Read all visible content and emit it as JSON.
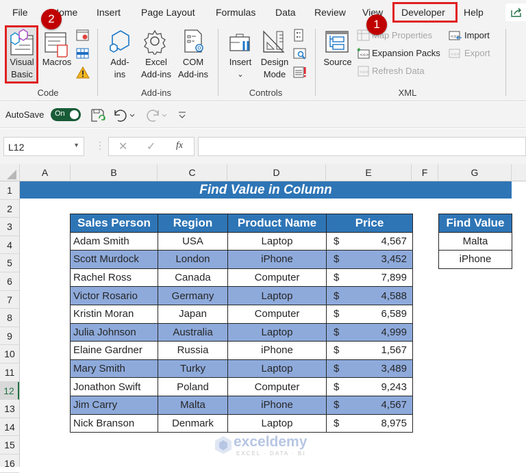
{
  "menu_tabs": [
    "File",
    "Home",
    "Insert",
    "Page Layout",
    "Formulas",
    "Data",
    "Review",
    "View",
    "Developer",
    "Help"
  ],
  "active_tab": "Developer",
  "share_icon": "share-icon",
  "step_badges": [
    "1",
    "2"
  ],
  "ribbon": {
    "code_group": {
      "label": "Code",
      "visual_basic": "Visual Basic",
      "visual_basic_lines": [
        "Visual",
        "Basic"
      ],
      "macros": "Macros",
      "small_icons": [
        "record-macro-icon",
        "relative-references-icon",
        "macro-security-icon"
      ]
    },
    "addins_group": {
      "label": "Add-ins",
      "addins_lines": [
        "Add-",
        "ins"
      ],
      "excel_addins_lines": [
        "Excel",
        "Add-ins"
      ],
      "com_addins_lines": [
        "COM",
        "Add-ins"
      ]
    },
    "controls_group": {
      "label": "Controls",
      "insert": "Insert",
      "insert_chevron": "⌄",
      "design_mode_lines": [
        "Design",
        "Mode"
      ],
      "small_icons": [
        "properties-icon",
        "view-code-icon",
        "run-dialog-icon"
      ]
    },
    "xml_group": {
      "label": "XML",
      "source": "Source",
      "map_properties": "Map Properties",
      "expansion_packs": "Expansion Packs",
      "refresh_data": "Refresh Data",
      "import": "Import",
      "export": "Export"
    }
  },
  "qat": {
    "autosave_label": "AutoSave",
    "autosave_state": "On"
  },
  "formula_bar": {
    "name_box": "L12",
    "fx": "fx",
    "formula": ""
  },
  "columns": [
    "A",
    "B",
    "C",
    "D",
    "E",
    "F",
    "G"
  ],
  "rows": [
    "1",
    "2",
    "3",
    "4",
    "5",
    "6",
    "7",
    "8",
    "9",
    "10",
    "11",
    "12",
    "13",
    "14",
    "15",
    "16"
  ],
  "selected_row": "12",
  "sheet": {
    "title": "Find Value in Column",
    "headers": [
      "Sales Person",
      "Region",
      "Product Name",
      "Price"
    ],
    "records": [
      {
        "person": "Adam Smith",
        "region": "USA",
        "product": "Laptop",
        "currency": "$",
        "price": "4,567"
      },
      {
        "person": "Scott Murdock",
        "region": "London",
        "product": "iPhone",
        "currency": "$",
        "price": "3,452"
      },
      {
        "person": "Rachel Ross",
        "region": "Canada",
        "product": "Computer",
        "currency": "$",
        "price": "7,899"
      },
      {
        "person": "Victor Rosario",
        "region": "Germany",
        "product": "Laptop",
        "currency": "$",
        "price": "4,588"
      },
      {
        "person": "Kristin Moran",
        "region": "Japan",
        "product": "Computer",
        "currency": "$",
        "price": "6,589"
      },
      {
        "person": "Julia Johnson",
        "region": "Australia",
        "product": "Laptop",
        "currency": "$",
        "price": "4,999"
      },
      {
        "person": "Elaine Gardner",
        "region": "Russia",
        "product": "iPhone",
        "currency": "$",
        "price": "1,567"
      },
      {
        "person": "Mary Smith",
        "region": "Turky",
        "product": "Laptop",
        "currency": "$",
        "price": "3,489"
      },
      {
        "person": "Jonathon Swift",
        "region": "Poland",
        "product": "Computer",
        "currency": "$",
        "price": "9,243"
      },
      {
        "person": "Jim Carry",
        "region": "Malta",
        "product": "iPhone",
        "currency": "$",
        "price": "4,567"
      },
      {
        "person": "Nick Branson",
        "region": "Denmark",
        "product": "Laptop",
        "currency": "$",
        "price": "8,975"
      }
    ],
    "find_header": "Find Value",
    "find_values": [
      "Malta",
      "iPhone"
    ]
  },
  "watermark": {
    "name": "exceldemy",
    "tagline": "EXCEL · DATA · BI"
  },
  "colors": {
    "header_blue": "#2e75b6",
    "band_blue": "#8eaadb",
    "highlight_red": "#e02020",
    "badge_red": "#c00000",
    "excel_green": "#217346"
  }
}
